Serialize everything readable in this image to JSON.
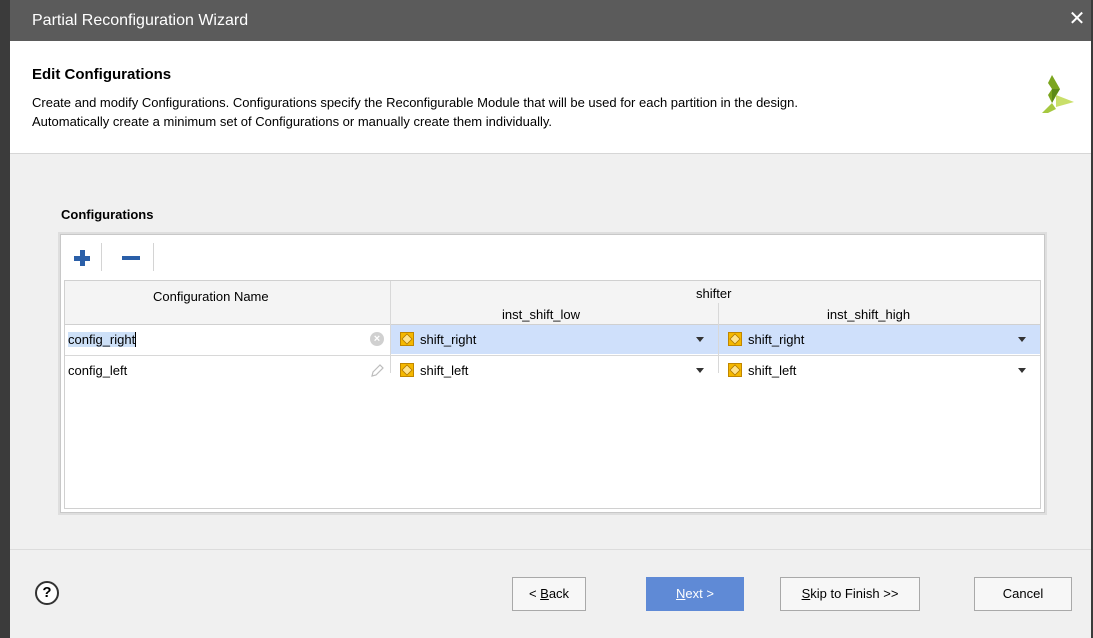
{
  "window": {
    "title": "Partial Reconfiguration Wizard",
    "close_symbol": "✕"
  },
  "header": {
    "heading": "Edit Configurations",
    "description_line1": "Create and modify Configurations. Configurations specify the Reconfigurable Module that will be used for each partition in the design.",
    "description_line2": "Automatically create a minimum set of Configurations or manually create them individually.",
    "logo_icon": "xilinx-logo-icon"
  },
  "configurations": {
    "section_label": "Configurations",
    "toolbar": {
      "add_icon": "plus-icon",
      "remove_icon": "minus-icon"
    },
    "columns": {
      "name_header": "Configuration Name",
      "group_header": "shifter",
      "col1_header": "inst_shift_low",
      "col2_header": "inst_shift_high"
    },
    "rows": [
      {
        "name": "config_right",
        "name_icon": "clear-icon",
        "inst_shift_low": "shift_right",
        "inst_shift_high": "shift_right",
        "selected": true
      },
      {
        "name": "config_left",
        "name_icon": "pencil-icon",
        "inst_shift_low": "shift_left",
        "inst_shift_high": "shift_left",
        "selected": false
      }
    ]
  },
  "footer": {
    "help_label": "?",
    "back_prefix": "< ",
    "back_mnemonic": "B",
    "back_rest": "ack",
    "next_mnemonic": "N",
    "next_rest": "ext >",
    "skip_mnemonic": "S",
    "skip_rest": "kip to Finish >>",
    "cancel_label": "Cancel"
  },
  "colors": {
    "titlebar": "#5b5b5b",
    "selection": "#cfe0fb",
    "primary_button": "#5f8ad6",
    "module_icon": "#f5b800"
  }
}
